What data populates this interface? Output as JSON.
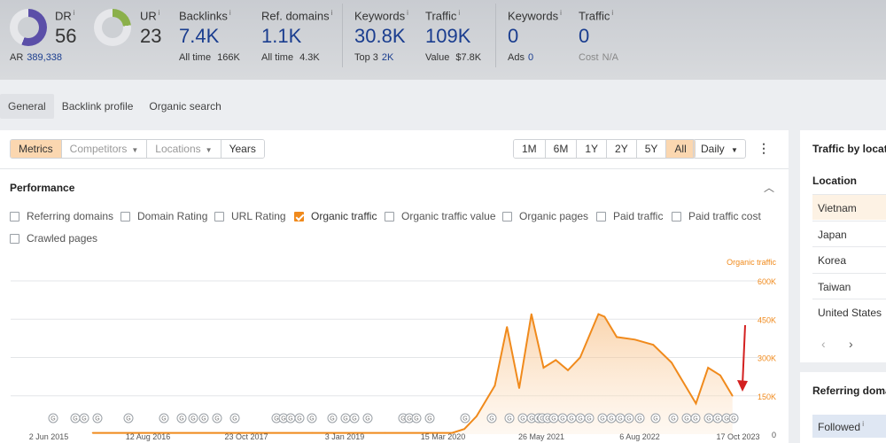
{
  "metrics": {
    "dr": {
      "label": "DR",
      "value": "56",
      "sub_label": "AR",
      "sub_value": "389,338",
      "ring_color": "#5b4fa8",
      "ring_percent": 56
    },
    "ur": {
      "label": "UR",
      "value": "23",
      "ring_color": "#8bb04a",
      "ring_percent": 23
    },
    "backlinks": {
      "label": "Backlinks",
      "value": "7.4K",
      "sub_label": "All time",
      "sub_value": "166K"
    },
    "ref_domains": {
      "label": "Ref. domains",
      "value": "1.1K",
      "sub_label": "All time",
      "sub_value": "4.3K"
    },
    "keywords": {
      "label": "Keywords",
      "value": "30.8K",
      "sub_label": "Top 3",
      "sub_value": "2K"
    },
    "traffic": {
      "label": "Traffic",
      "value": "109K",
      "sub_label": "Value",
      "sub_value": "$7.8K"
    },
    "paid_keywords": {
      "label": "Keywords",
      "value": "0",
      "sub_label": "Ads",
      "sub_value": "0"
    },
    "paid_traffic": {
      "label": "Traffic",
      "value": "0",
      "sub_label": "Cost",
      "sub_value": "N/A"
    }
  },
  "tabs": [
    "General",
    "Backlink profile",
    "Organic search"
  ],
  "toolbar": {
    "filters": [
      "Metrics",
      "Competitors",
      "Locations",
      "Years"
    ],
    "ranges": [
      "1M",
      "6M",
      "1Y",
      "2Y",
      "5Y",
      "All"
    ],
    "selected_range": "All",
    "interval": "Daily",
    "more_icon": "more-vertical-icon"
  },
  "performance": {
    "title": "Performance",
    "checkboxes": [
      {
        "label": "Referring domains",
        "checked": false
      },
      {
        "label": "Domain Rating",
        "checked": false
      },
      {
        "label": "URL Rating",
        "checked": false
      },
      {
        "label": "Organic traffic",
        "checked": true
      },
      {
        "label": "Organic traffic value",
        "checked": false
      },
      {
        "label": "Organic pages",
        "checked": false
      },
      {
        "label": "Paid traffic",
        "checked": false
      },
      {
        "label": "Paid traffic cost",
        "checked": false
      },
      {
        "label": "Crawled pages",
        "checked": false
      }
    ]
  },
  "chart_data": {
    "type": "area",
    "series": [
      {
        "name": "Organic traffic",
        "color": "#f08a1c"
      }
    ],
    "y_axis_label": "Organic traffic",
    "y_ticks": [
      "600K",
      "450K",
      "300K",
      "150K",
      "0"
    ],
    "ylim": [
      0,
      600000
    ],
    "x_ticks": [
      "2 Jun 2015",
      "12 Aug 2016",
      "23 Oct 2017",
      "3 Jan 2019",
      "15 Mar 2020",
      "26 May 2021",
      "6 Aug 2022",
      "17 Oct 2023"
    ],
    "x": [
      "2015-01",
      "2016-01",
      "2017-01",
      "2018-01",
      "2019-01",
      "2019-12",
      "2020-02",
      "2020-04",
      "2020-07",
      "2020-09",
      "2020-11",
      "2021-01",
      "2021-03",
      "2021-05",
      "2021-07",
      "2021-09",
      "2021-12",
      "2022-01",
      "2022-03",
      "2022-06",
      "2022-09",
      "2022-12",
      "2023-02",
      "2023-04",
      "2023-06",
      "2023-08",
      "2023-10"
    ],
    "values": [
      5000,
      5000,
      5000,
      5000,
      5000,
      5000,
      20000,
      70000,
      190000,
      420000,
      180000,
      470000,
      260000,
      290000,
      250000,
      300000,
      470000,
      460000,
      380000,
      370000,
      350000,
      280000,
      200000,
      120000,
      260000,
      230000,
      150000
    ],
    "grid": true,
    "annotation_icon": "google-update-icon",
    "arrow_icon": "red-arrow-down-icon"
  },
  "right_panel": {
    "title": "Traffic by locat",
    "column_header": "Location",
    "rows": [
      "Vietnam",
      "Japan",
      "Korea",
      "Taiwan",
      "United States"
    ],
    "prev_icon": "chevron-left-icon",
    "next_icon": "chevron-right-icon"
  },
  "ref_panel": {
    "title": "Referring doma",
    "row": "Followed"
  }
}
